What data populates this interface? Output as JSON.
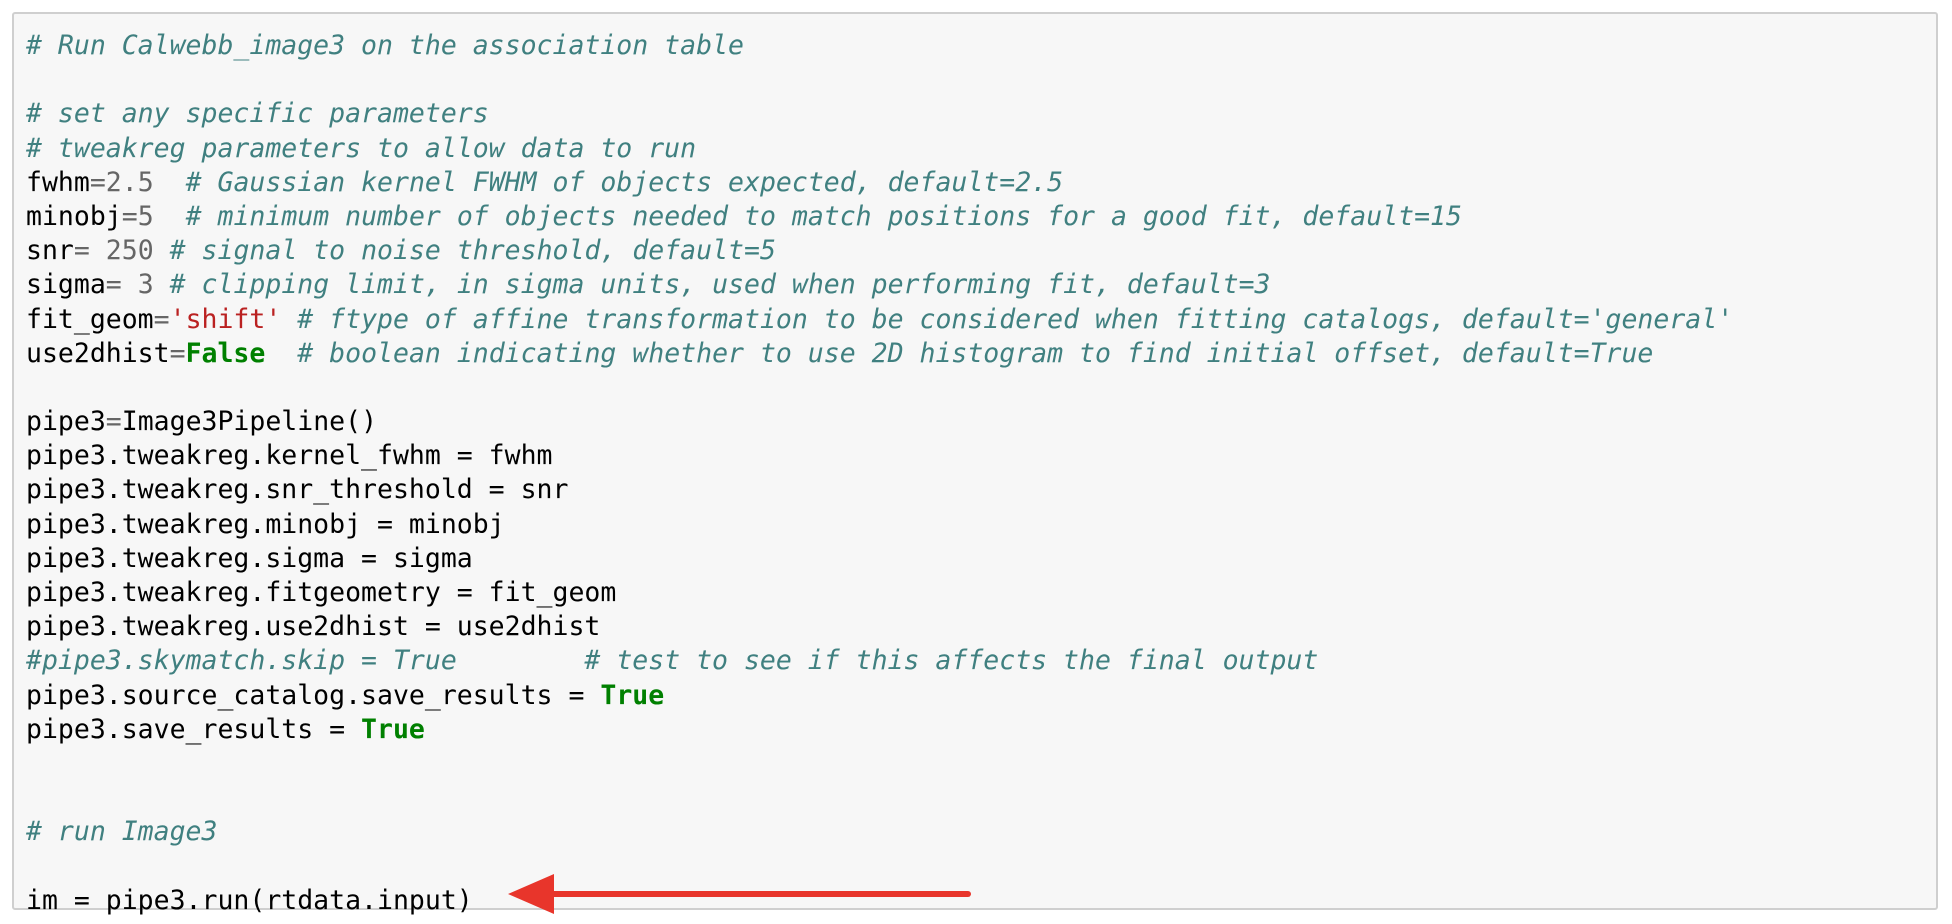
{
  "cell": {
    "lines": [
      {
        "comment": "# Run Calwebb_image3 on the association table"
      },
      {},
      {
        "comment": "# set any specific parameters"
      },
      {
        "comment": "# tweakreg parameters to allow data to run"
      },
      {
        "name": "fwhm",
        "op": "=",
        "value": "2.5",
        "gap": "  ",
        "comment": "# Gaussian kernel FWHM of objects expected, default=2.5"
      },
      {
        "name": "minobj",
        "op": "=",
        "value": "5",
        "gap": "  ",
        "comment": "# minimum number of objects needed to match positions for a good fit, default=15"
      },
      {
        "name": "snr",
        "op": "=",
        "value": " 250",
        "gap": " ",
        "comment": "# signal to noise threshold, default=5"
      },
      {
        "name": "sigma",
        "op": "=",
        "value": " 3",
        "gap": " ",
        "comment": "# clipping limit, in sigma units, used when performing fit, default=3"
      },
      {
        "name": "fit_geom",
        "op": "=",
        "value": "'shift'",
        "gap": " ",
        "comment": "# ftype of affine transformation to be considered when fitting catalogs, default='general'"
      },
      {
        "name": "use2dhist",
        "op": "=",
        "value": "False",
        "gap": "  ",
        "comment": "# boolean indicating whether to use 2D histogram to find initial offset, default=True"
      },
      {},
      {
        "name": "pipe3",
        "op": "=",
        "code": "Image3Pipeline()"
      },
      {
        "code": "pipe3.tweakreg.kernel_fwhm = fwhm"
      },
      {
        "code": "pipe3.tweakreg.snr_threshold = snr"
      },
      {
        "code": "pipe3.tweakreg.minobj = minobj"
      },
      {
        "code": "pipe3.tweakreg.sigma = sigma"
      },
      {
        "code": "pipe3.tweakreg.fitgeometry = fit_geom"
      },
      {
        "code": "pipe3.tweakreg.use2dhist = use2dhist"
      },
      {
        "comment": "#pipe3.skymatch.skip = True",
        "gap2": "        ",
        "comment2": "# test to see if this affects the final output"
      },
      {
        "code": "pipe3.source_catalog.save_results = ",
        "value": "True"
      },
      {
        "code": "pipe3.save_results = ",
        "value": "True"
      },
      {},
      {},
      {
        "comment": "# run Image3"
      },
      {},
      {
        "code": "im = pipe3.run(rtdata.input)"
      }
    ]
  },
  "colors": {
    "comment": "#408080",
    "number": "#666666",
    "string": "#ba2121",
    "keyword": "#008000",
    "arrow": "#e8352b",
    "cell_background": "#f7f7f7",
    "cell_border": "#cfcfcf"
  },
  "annotation": {
    "icon": "arrow-left-icon"
  }
}
